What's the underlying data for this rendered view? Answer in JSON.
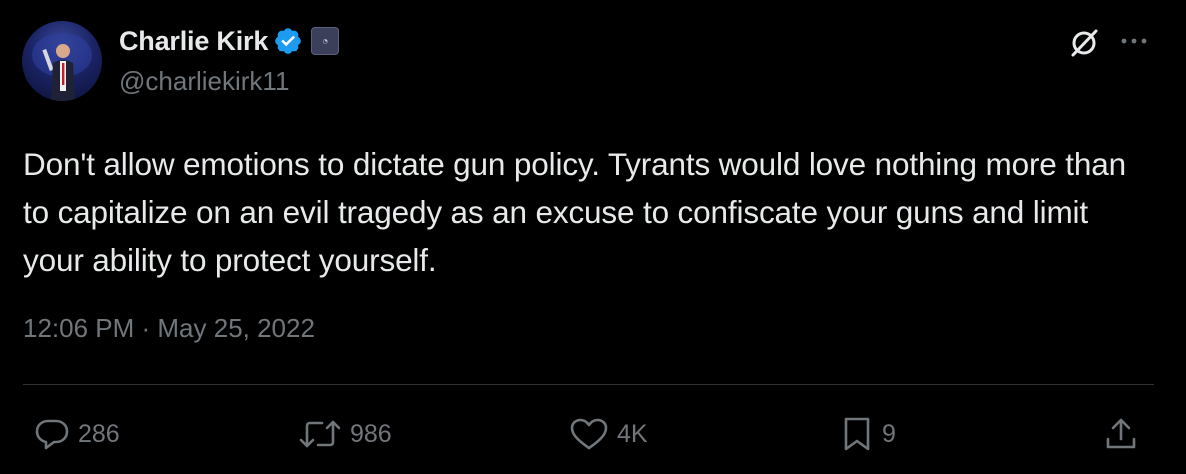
{
  "author": {
    "name": "Charlie Kirk",
    "handle": "@charliekirk11",
    "verified_color": "#1d9bf0",
    "affiliation_badge_text": "TPUSA"
  },
  "tweet": {
    "text": "Don't allow emotions to dictate gun policy. Tyrants would love nothing more than to capitalize on an evil tragedy as an excuse to confiscate your guns and limit your ability to protect yourself.",
    "timestamp": "12:06 PM · May 25, 2022"
  },
  "actions": {
    "reply": {
      "icon": "reply-icon",
      "count": "286"
    },
    "retweet": {
      "icon": "retweet-icon",
      "count": "986"
    },
    "like": {
      "icon": "heart-icon",
      "count": "4K"
    },
    "bookmark": {
      "icon": "bookmark-icon",
      "count": "9"
    },
    "share": {
      "icon": "share-icon"
    }
  },
  "top_icons": [
    "grok-icon",
    "more-icon"
  ],
  "colors": {
    "background": "#000000",
    "text": "#e7e9ea",
    "muted": "#71767b",
    "divider": "#2f3336"
  }
}
